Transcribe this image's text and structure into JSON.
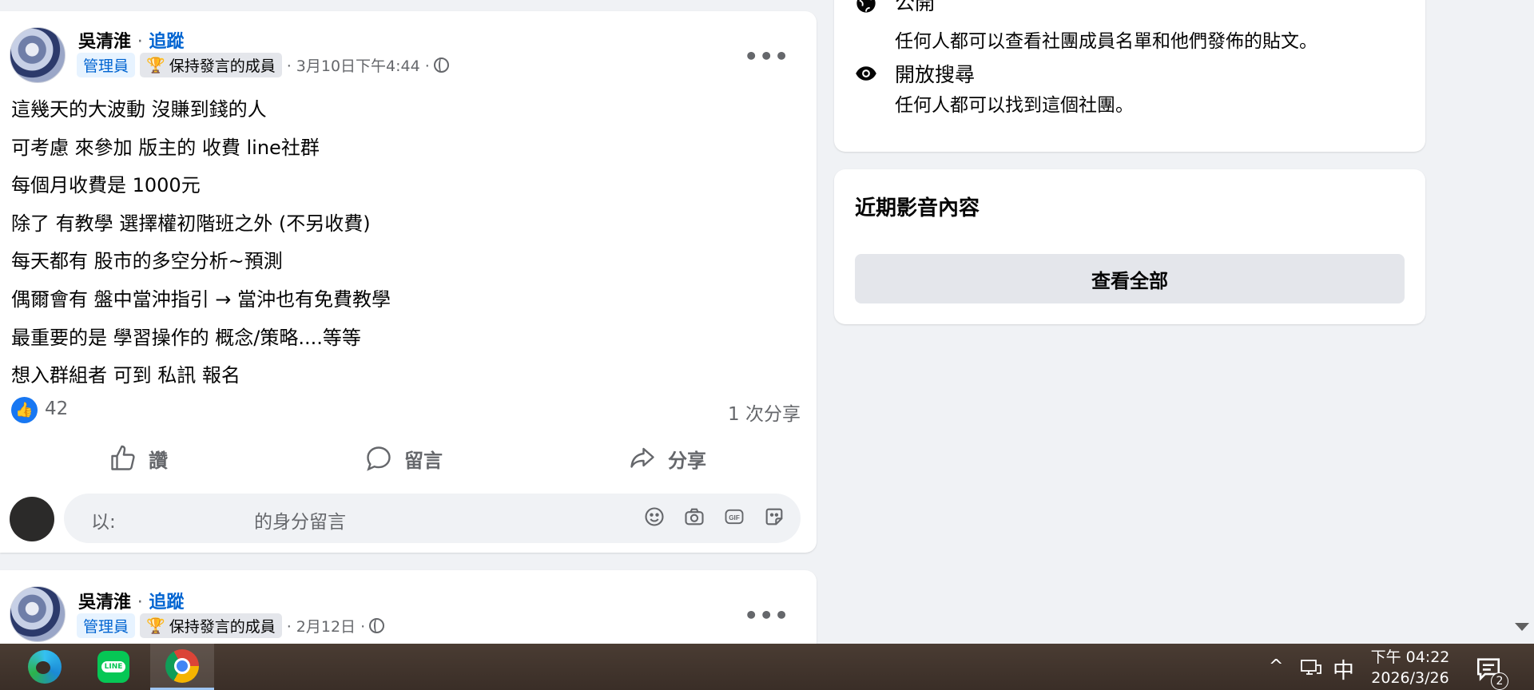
{
  "posts": [
    {
      "author": "吳清淮",
      "separator": "·",
      "follow_label": "追蹤",
      "badge_admin": "管理員",
      "badge_member": "保持發言的成員",
      "date": "· 3月10日下午4:44 ·",
      "more_label": "•••",
      "lines": [
        "這幾天的大波動 沒賺到錢的人",
        "可考慮 來參加 版主的 收費 line社群",
        "每個月收費是 1000元",
        "除了 有教學 選擇權初階班之外 (不另收費)",
        "每天都有 股市的多空分析~預測",
        "偶爾會有 盤中當沖指引 → 當沖也有免費教學",
        "最重要的是 學習操作的 概念/策略....等等",
        "想入群組者 可到 私訊 報名"
      ],
      "like_count": "42",
      "share_count": "1 次分享",
      "actions": {
        "like": "讚",
        "comment": "留言",
        "share": "分享"
      },
      "comment_placeholder_prefix": "以:",
      "comment_placeholder_suffix": "的身分留言"
    },
    {
      "author": "吳清淮",
      "separator": "·",
      "follow_label": "追蹤",
      "badge_admin": "管理員",
      "badge_member": "保持發言的成員",
      "date": "· 2月12日 ·",
      "more_label": "•••"
    }
  ],
  "sidebar": {
    "about_items": [
      {
        "title": "公開",
        "desc": "任何人都可以查看社團成員名單和他們發佈的貼文。",
        "icon": "globe-icon"
      },
      {
        "title": "開放搜尋",
        "desc": "任何人都可以找到這個社團。",
        "icon": "eye-icon"
      }
    ],
    "recent_media_title": "近期影音內容",
    "see_all_label": "查看全部"
  },
  "taskbar": {
    "apps": [
      "edge-icon",
      "line-icon",
      "chrome-icon"
    ],
    "line_label": "LINE",
    "tray_caret": "^",
    "ime_label": "中",
    "clock_time": "下午 04:22",
    "clock_date": "2026/3/26",
    "notification_count": "2"
  },
  "colors": {
    "accent": "#0064d1",
    "like": "#1877f2",
    "page_bg": "#f0f2f5"
  }
}
